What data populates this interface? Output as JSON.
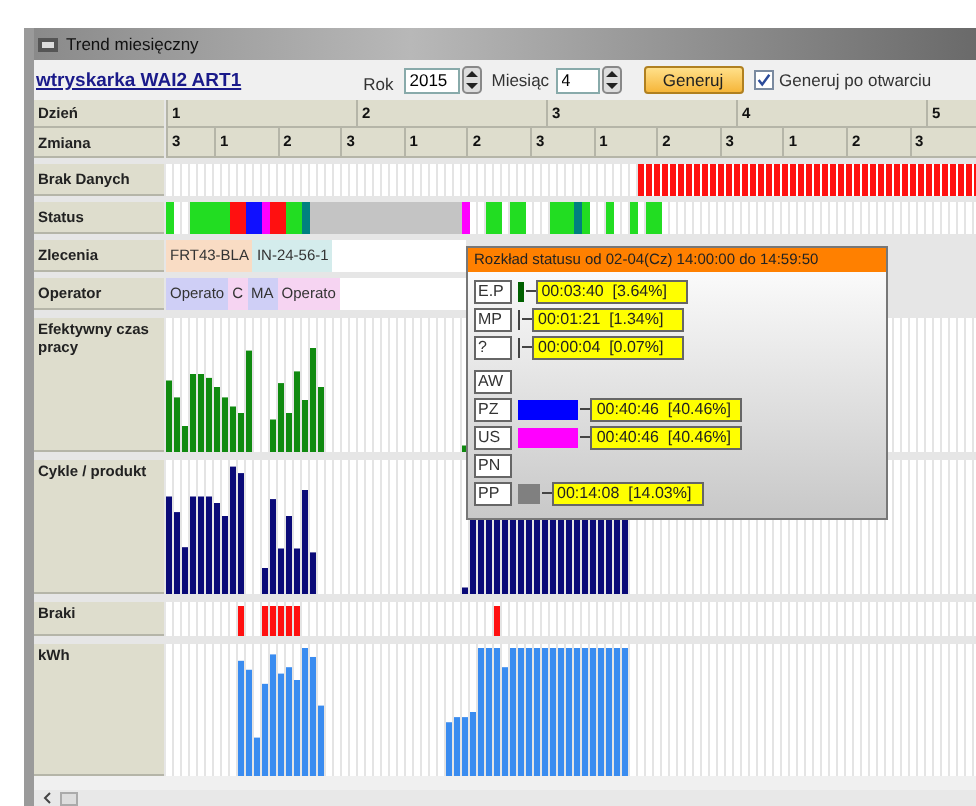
{
  "window": {
    "title": "Trend miesięczny"
  },
  "machine_link": "wtryskarka WAI2 ART1",
  "year": {
    "label": "Rok",
    "value": "2015"
  },
  "month": {
    "label": "Miesiąc",
    "value": "4"
  },
  "generate_button": "Generuj",
  "auto_generate": {
    "label": "Generuj po otwarciu",
    "checked": true
  },
  "rows": {
    "day": "Dzień",
    "shift": "Zmiana",
    "missing_data": "Brak Danych",
    "status": "Status",
    "orders": "Zlecenia",
    "operator": "Operator",
    "effective_time": "Efektywny czas pracy",
    "cycles": "Cykle / produkt",
    "rejects": "Braki",
    "energy": "kWh"
  },
  "days": [
    "1",
    "2",
    "3",
    "4",
    "5"
  ],
  "shifts": [
    "3",
    "1",
    "2",
    "3",
    "1",
    "2",
    "3",
    "1",
    "2",
    "3",
    "1",
    "2",
    "3"
  ],
  "orders": [
    {
      "label": "FRT43-BLA",
      "color": "#f9dcc4"
    },
    {
      "label": "IN-24-56-1",
      "color": "#d4ecec"
    }
  ],
  "operators": [
    {
      "label": "Operato",
      "color": "#cfcff6"
    },
    {
      "label": "C",
      "color": "#f6d4f2"
    },
    {
      "label": "MA",
      "color": "#cfcff6"
    },
    {
      "label": "Operato",
      "color": "#f6d4f2"
    }
  ],
  "popup": {
    "title": "Rozkład statusu od 02-04(Cz) 14:00:00 do 14:59:50",
    "items": [
      {
        "code": "E.P",
        "value": "00:03:40  [3.64%]",
        "color": "#006000"
      },
      {
        "code": "MP",
        "value": "00:01:21  [1.34%]"
      },
      {
        "code": "?",
        "value": "00:00:04  [0.07%]"
      },
      {
        "code": "AW"
      },
      {
        "code": "PZ",
        "value": "00:40:46  [40.46%]",
        "color": "#0000ff"
      },
      {
        "code": "US",
        "value": "00:40:46  [40.46%]",
        "color": "#ff00ff"
      },
      {
        "code": "PN"
      },
      {
        "code": "PP",
        "value": "00:14:08  [14.03%]",
        "color": "#808080"
      }
    ]
  }
}
